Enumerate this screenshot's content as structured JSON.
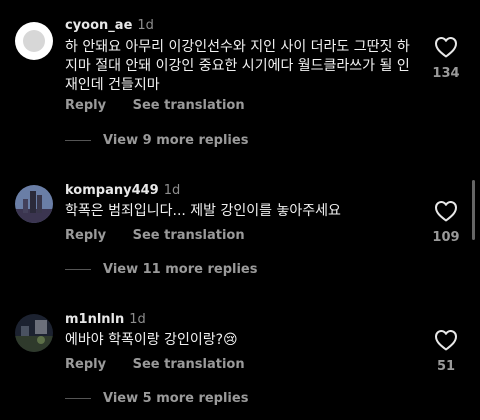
{
  "comments": [
    {
      "username": "cyoon_ae",
      "time": "1d",
      "text_lines": [
        "하 안돼요 아무리 이강인선수와 지인 사이 더라도 그딴짓 하",
        "지마 절대 안돼 이강인 중요한 시기에다 월드클라쓰가 될 인",
        "재인데 건들지마"
      ],
      "likes": "134",
      "reply_label": "Reply",
      "translate_label": "See translation",
      "view_more": "View 9 more replies"
    },
    {
      "username": "kompany449",
      "time": "1d",
      "text_lines": [
        "학폭은 범죄입니다... 제발 강인이를 놓아주세요"
      ],
      "likes": "109",
      "reply_label": "Reply",
      "translate_label": "See translation",
      "view_more": "View 11 more replies"
    },
    {
      "username": "m1nlnln",
      "time": "1d",
      "text_lines": [
        "에바야 학폭이랑 강인이랑?😢"
      ],
      "likes": "51",
      "reply_label": "Reply",
      "translate_label": "See translation",
      "view_more": "View 5 more replies"
    }
  ],
  "icons": {
    "like": "heart-outline-icon"
  },
  "colors": {
    "background": "#000000",
    "text": "#f2f2f2",
    "muted": "#9a9a9a"
  }
}
